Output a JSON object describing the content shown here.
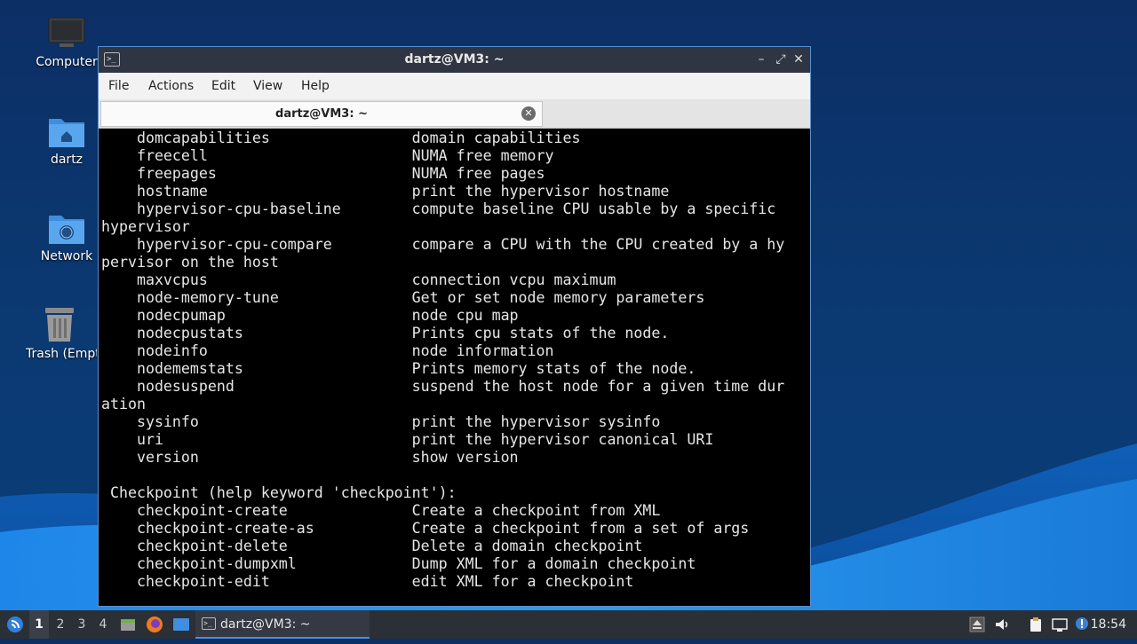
{
  "desktop": {
    "icons": [
      {
        "label": "Computer",
        "icon": "computer-icon"
      },
      {
        "label": "dartz",
        "icon": "home-folder-icon"
      },
      {
        "label": "Network",
        "icon": "network-folder-icon"
      },
      {
        "label": "Trash (Empty)",
        "icon": "trash-icon"
      }
    ]
  },
  "window": {
    "title": "dartz@VM3: ~",
    "controls": {
      "minimize": "–",
      "maximize": "⤢",
      "close": "✕"
    },
    "menu": [
      "File",
      "Actions",
      "Edit",
      "View",
      "Help"
    ],
    "tab": {
      "label": "dartz@VM3: ~",
      "close": "✕"
    },
    "terminal_lines": [
      "    domcapabilities                domain capabilities",
      "    freecell                       NUMA free memory",
      "    freepages                      NUMA free pages",
      "    hostname                       print the hypervisor hostname",
      "    hypervisor-cpu-baseline        compute baseline CPU usable by a specific",
      "hypervisor",
      "    hypervisor-cpu-compare         compare a CPU with the CPU created by a hy",
      "pervisor on the host",
      "    maxvcpus                       connection vcpu maximum",
      "    node-memory-tune               Get or set node memory parameters",
      "    nodecpumap                     node cpu map",
      "    nodecpustats                   Prints cpu stats of the node.",
      "    nodeinfo                       node information",
      "    nodememstats                   Prints memory stats of the node.",
      "    nodesuspend                    suspend the host node for a given time dur",
      "ation",
      "    sysinfo                        print the hypervisor sysinfo",
      "    uri                            print the hypervisor canonical URI",
      "    version                        show version",
      "",
      " Checkpoint (help keyword 'checkpoint'):",
      "    checkpoint-create              Create a checkpoint from XML",
      "    checkpoint-create-as           Create a checkpoint from a set of args",
      "    checkpoint-delete              Delete a domain checkpoint",
      "    checkpoint-dumpxml             Dump XML for a domain checkpoint",
      "    checkpoint-edit                edit XML for a checkpoint"
    ]
  },
  "taskbar": {
    "workspaces": [
      "1",
      "2",
      "3",
      "4"
    ],
    "active_workspace": "1",
    "task_label": "dartz@VM3: ~",
    "clock": "18:54",
    "tray_icons": [
      "eject-icon",
      "volume-icon",
      "clipboard-icon",
      "network-icon",
      "update-notifier-icon"
    ],
    "launchers": [
      "start-menu-icon",
      "file-manager-icon",
      "firefox-icon",
      "show-desktop-icon"
    ]
  },
  "colors": {
    "accent": "#4a8fe0",
    "taskbar": "#2b2f36",
    "titlebar": "#2f3542",
    "terminal_bg": "#000000",
    "terminal_fg": "#e6e6e6"
  }
}
